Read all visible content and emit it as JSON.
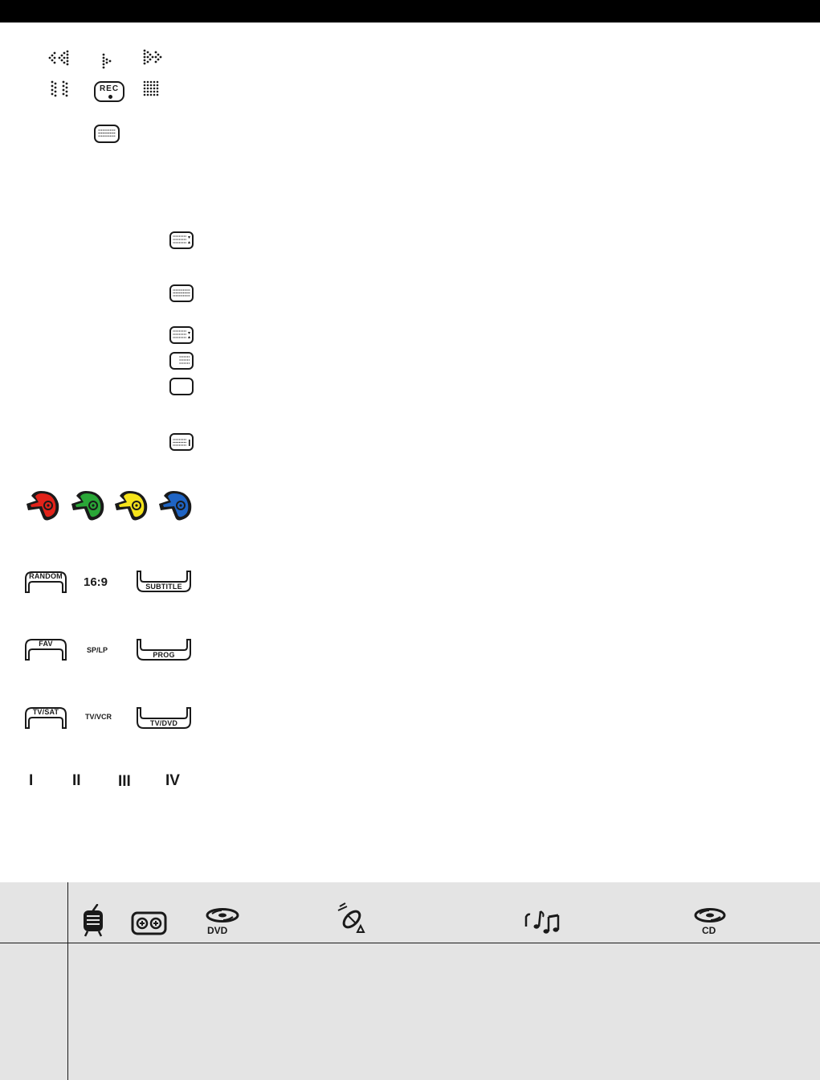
{
  "keys": {
    "rec_label": "REC",
    "aspect_label": "16:9",
    "speed_label": "SP/LP",
    "tvvcr_label": "TV/VCR"
  },
  "curved_keys": {
    "random": "RANDOM",
    "subtitle": "SUBTITLE",
    "fav": "FAV",
    "prog": "PROG",
    "tvsat": "TV/SAT",
    "tvdvd": "TV/DVD"
  },
  "roman_keys": [
    "I",
    "II",
    "III",
    "IV"
  ],
  "color_keys": [
    {
      "name": "red",
      "color": "#e2231a"
    },
    {
      "name": "green",
      "color": "#2aa737"
    },
    {
      "name": "yellow",
      "color": "#f6e41b"
    },
    {
      "name": "blue",
      "color": "#1f64c4"
    }
  ],
  "devices": {
    "dvd_label": "DVD",
    "cd_label": "CD"
  }
}
